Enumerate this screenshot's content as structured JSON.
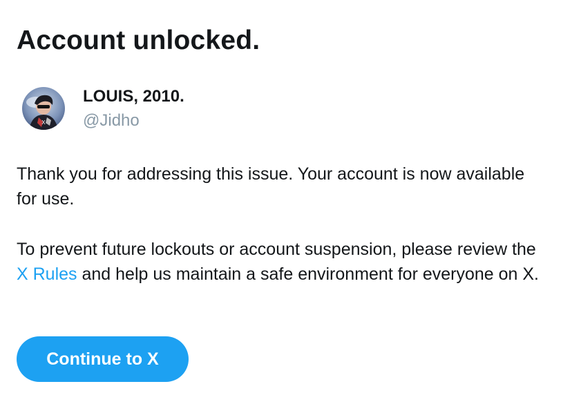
{
  "page": {
    "title": "Account unlocked."
  },
  "profile": {
    "display_name": "LOUIS, 2010.",
    "handle": "@Jidho",
    "avatar_icon": "user-avatar-photo"
  },
  "message": {
    "paragraph1": "Thank you for addressing this issue. Your account is now available for use.",
    "paragraph2_before": "To prevent future lockouts or account suspension, please review the ",
    "paragraph2_link": "X Rules",
    "paragraph2_after": " and help us maintain a safe environment for everyone on X."
  },
  "actions": {
    "continue_label": "Continue to X"
  },
  "colors": {
    "accent": "#1da1f2",
    "text": "#14171a",
    "secondary_text": "#8899a6"
  }
}
